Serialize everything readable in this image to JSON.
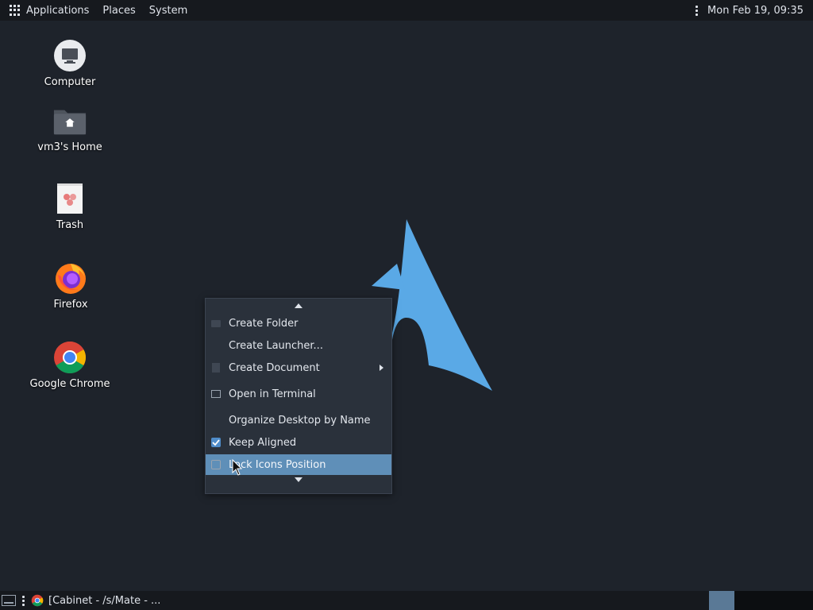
{
  "top_panel": {
    "menus": [
      "Applications",
      "Places",
      "System"
    ],
    "clock": "Mon Feb 19, 09:35"
  },
  "desktop_icons": [
    {
      "label": "Computer",
      "icon": "computer-icon"
    },
    {
      "label": "vm3's Home",
      "icon": "home-folder-icon"
    },
    {
      "label": "Trash",
      "icon": "trash-icon"
    },
    {
      "label": "Firefox",
      "icon": "firefox-icon"
    },
    {
      "label": "Google Chrome",
      "icon": "chrome-icon"
    }
  ],
  "context_menu": {
    "items": [
      {
        "label": "Create Folder",
        "icon": "folder-icon"
      },
      {
        "label": "Create Launcher...",
        "icon": ""
      },
      {
        "label": "Create Document",
        "icon": "document-icon",
        "submenu": true
      },
      {
        "label": "Open in Terminal",
        "icon": "terminal-icon"
      },
      {
        "label": "Organize Desktop by Name",
        "icon": ""
      },
      {
        "label": "Keep Aligned",
        "checkbox": true,
        "checked": true
      },
      {
        "label": "Lock Icons Position",
        "checkbox": true,
        "checked": false,
        "highlighted": true
      }
    ]
  },
  "bottom_panel": {
    "task_label": "[Cabinet - /s/Mate - ..."
  },
  "colors": {
    "desktop_bg": "#1e232b",
    "panel_bg": "#16191e",
    "menu_bg": "#2a313b",
    "highlight": "#5f8fb8",
    "arch_blue": "#5aa9e6"
  }
}
